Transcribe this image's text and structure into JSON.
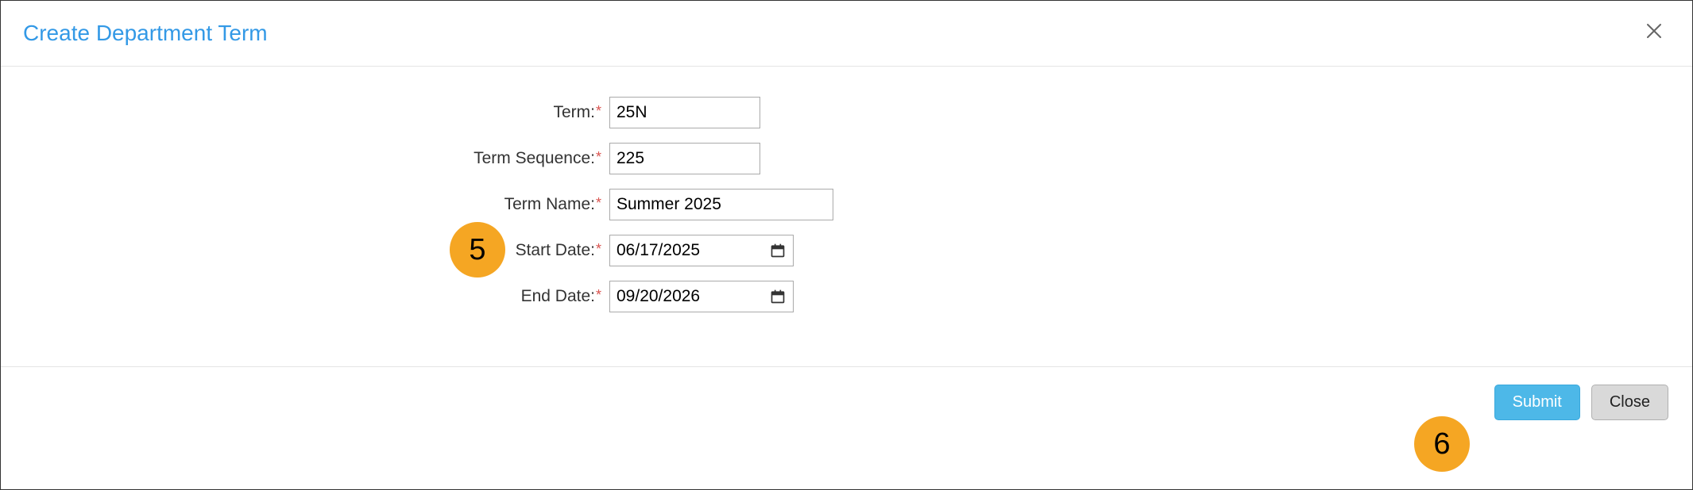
{
  "dialog": {
    "title": "Create Department Term"
  },
  "form": {
    "term": {
      "label": "Term:",
      "value": "25N"
    },
    "term_sequence": {
      "label": "Term Sequence:",
      "value": "225"
    },
    "term_name": {
      "label": "Term Name:",
      "value": "Summer 2025"
    },
    "start_date": {
      "label": "Start Date:",
      "value": "06/17/2025"
    },
    "end_date": {
      "label": "End Date:",
      "value": "09/20/2026"
    }
  },
  "buttons": {
    "submit": "Submit",
    "close": "Close"
  },
  "callouts": {
    "step5": "5",
    "step6": "6"
  }
}
